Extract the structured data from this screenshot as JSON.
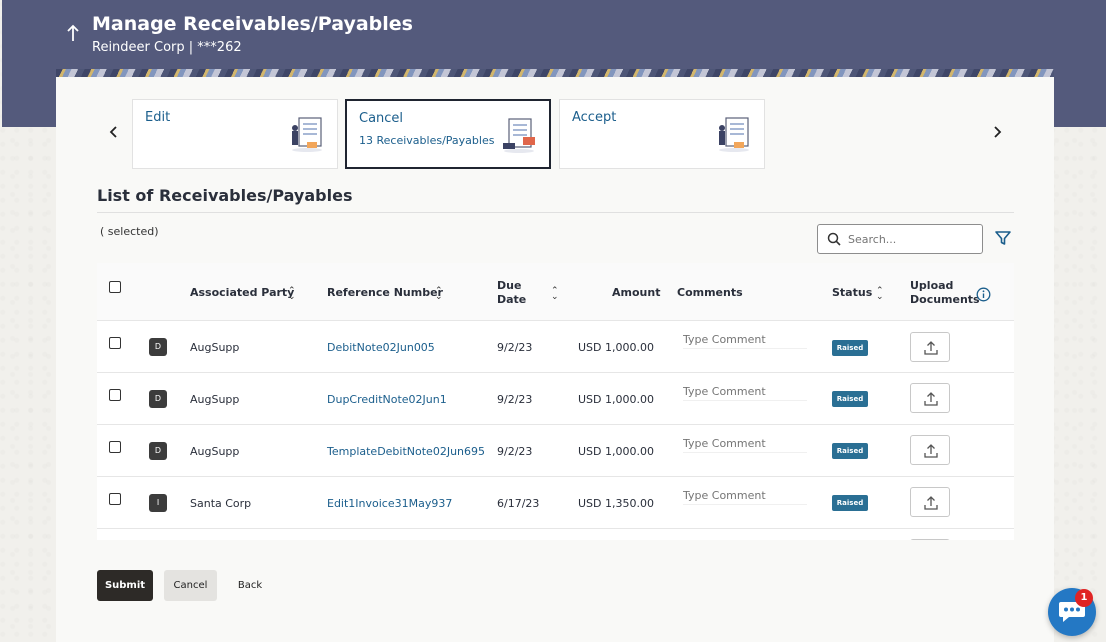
{
  "header": {
    "title": "Manage Receivables/Payables",
    "subtitle": "Reindeer Corp | ***262"
  },
  "tiles": [
    {
      "title": "Edit",
      "sub": ""
    },
    {
      "title": "Cancel",
      "sub": "13 Receivables/Payables"
    },
    {
      "title": "Accept",
      "sub": ""
    }
  ],
  "list": {
    "title": "List of Receivables/Payables",
    "selected_text": "( selected)",
    "search_placeholder": "Search...",
    "columns": {
      "associated_party": "Associated Party",
      "reference_number": "Reference Number",
      "due_date_line1": "Due",
      "due_date_line2": "Date",
      "amount": "Amount",
      "comments": "Comments",
      "status": "Status",
      "upload_line1": "Upload",
      "upload_line2": "Documents"
    },
    "rows": [
      {
        "avatar": "D",
        "party": "AugSupp",
        "reference": "DebitNote02Jun005",
        "due": "9/2/23",
        "amount": "USD 1,000.00",
        "comment_placeholder": "Type Comment",
        "status": "Raised"
      },
      {
        "avatar": "D",
        "party": "AugSupp",
        "reference": "DupCreditNote02Jun1",
        "due": "9/2/23",
        "amount": "USD 1,000.00",
        "comment_placeholder": "Type Comment",
        "status": "Raised"
      },
      {
        "avatar": "D",
        "party": "AugSupp",
        "reference": "TemplateDebitNote02Jun695",
        "due": "9/2/23",
        "amount": "USD 1,000.00",
        "comment_placeholder": "Type Comment",
        "status": "Raised"
      },
      {
        "avatar": "I",
        "party": "Santa Corp",
        "reference": "Edit1Invoice31May937",
        "due": "6/17/23",
        "amount": "USD 1,350.00",
        "comment_placeholder": "Type Comment",
        "status": "Raised"
      }
    ]
  },
  "actions": {
    "submit": "Submit",
    "cancel": "Cancel",
    "back": "Back"
  },
  "chat": {
    "badge_count": "1"
  },
  "icons": {
    "back": "arrow-up-icon",
    "prev": "chevron-left-icon",
    "next": "chevron-right-icon",
    "search": "search-icon",
    "filter": "filter-icon",
    "info": "info-icon",
    "upload": "upload-icon",
    "chat": "chat-icon"
  },
  "colors": {
    "header": "#545a7c",
    "link": "#1b5e8c",
    "badge": "#2a6f94",
    "submit": "#2d2a27",
    "chat": "#2478c4",
    "notification": "#e02424"
  }
}
